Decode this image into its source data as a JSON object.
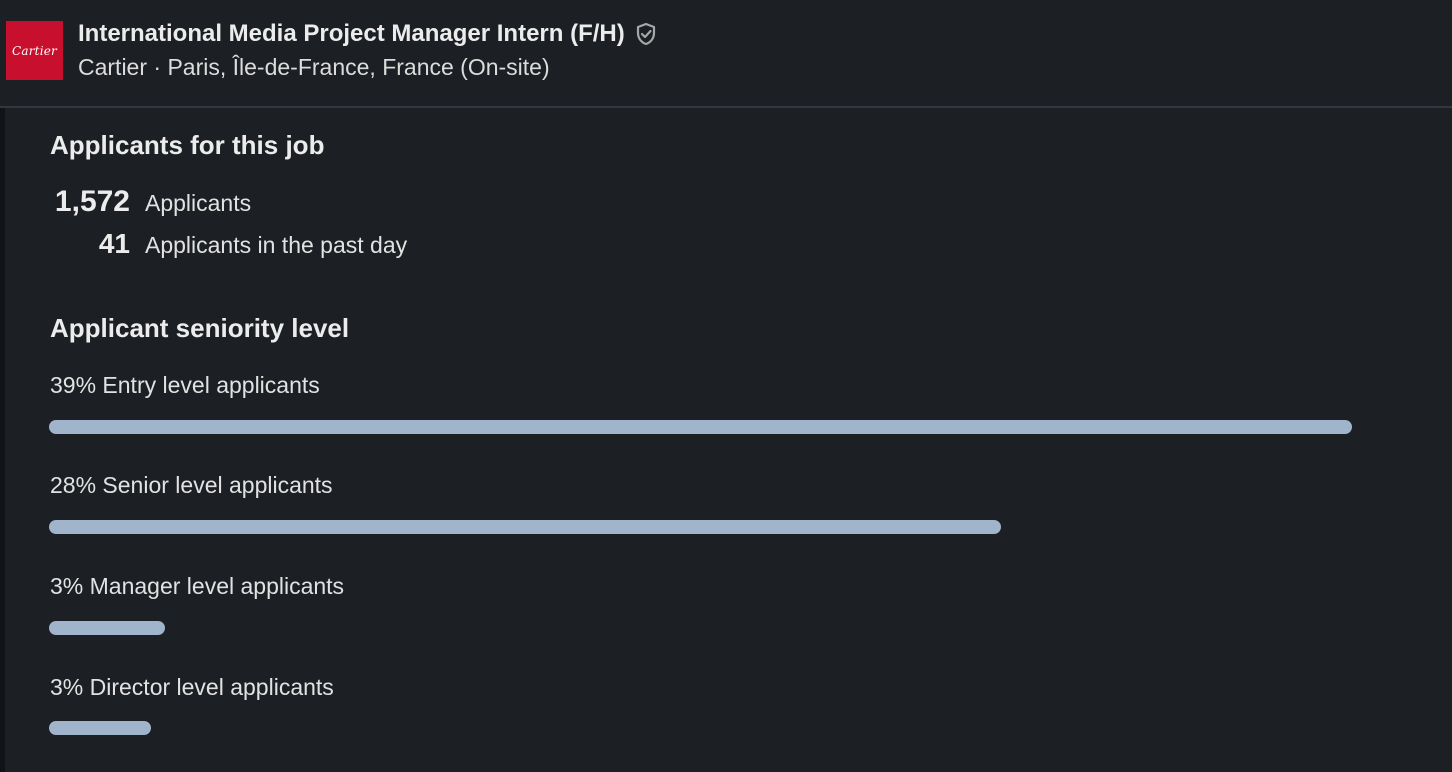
{
  "header": {
    "logo_text": "Cartier",
    "job_title": "International Media Project Manager Intern (F/H)",
    "verified_icon": "shield-check-icon",
    "subtitle": "Cartier · Paris, Île-de-France, France (On-site)"
  },
  "applicants": {
    "title": "Applicants for this job",
    "total_value": "1,572",
    "total_label": "Applicants",
    "past_day_value": "41",
    "past_day_label": "Applicants in the past day"
  },
  "seniority": {
    "title": "Applicant seniority level",
    "levels": [
      {
        "label": "39% Entry level applicants",
        "fraction": 1.0
      },
      {
        "label": "28% Senior level applicants",
        "fraction": 0.731
      },
      {
        "label": "3% Manager level applicants",
        "fraction": 0.089
      },
      {
        "label": "3% Director level applicants",
        "fraction": 0.078
      }
    ],
    "bar_color": "#a0b4cc"
  }
}
